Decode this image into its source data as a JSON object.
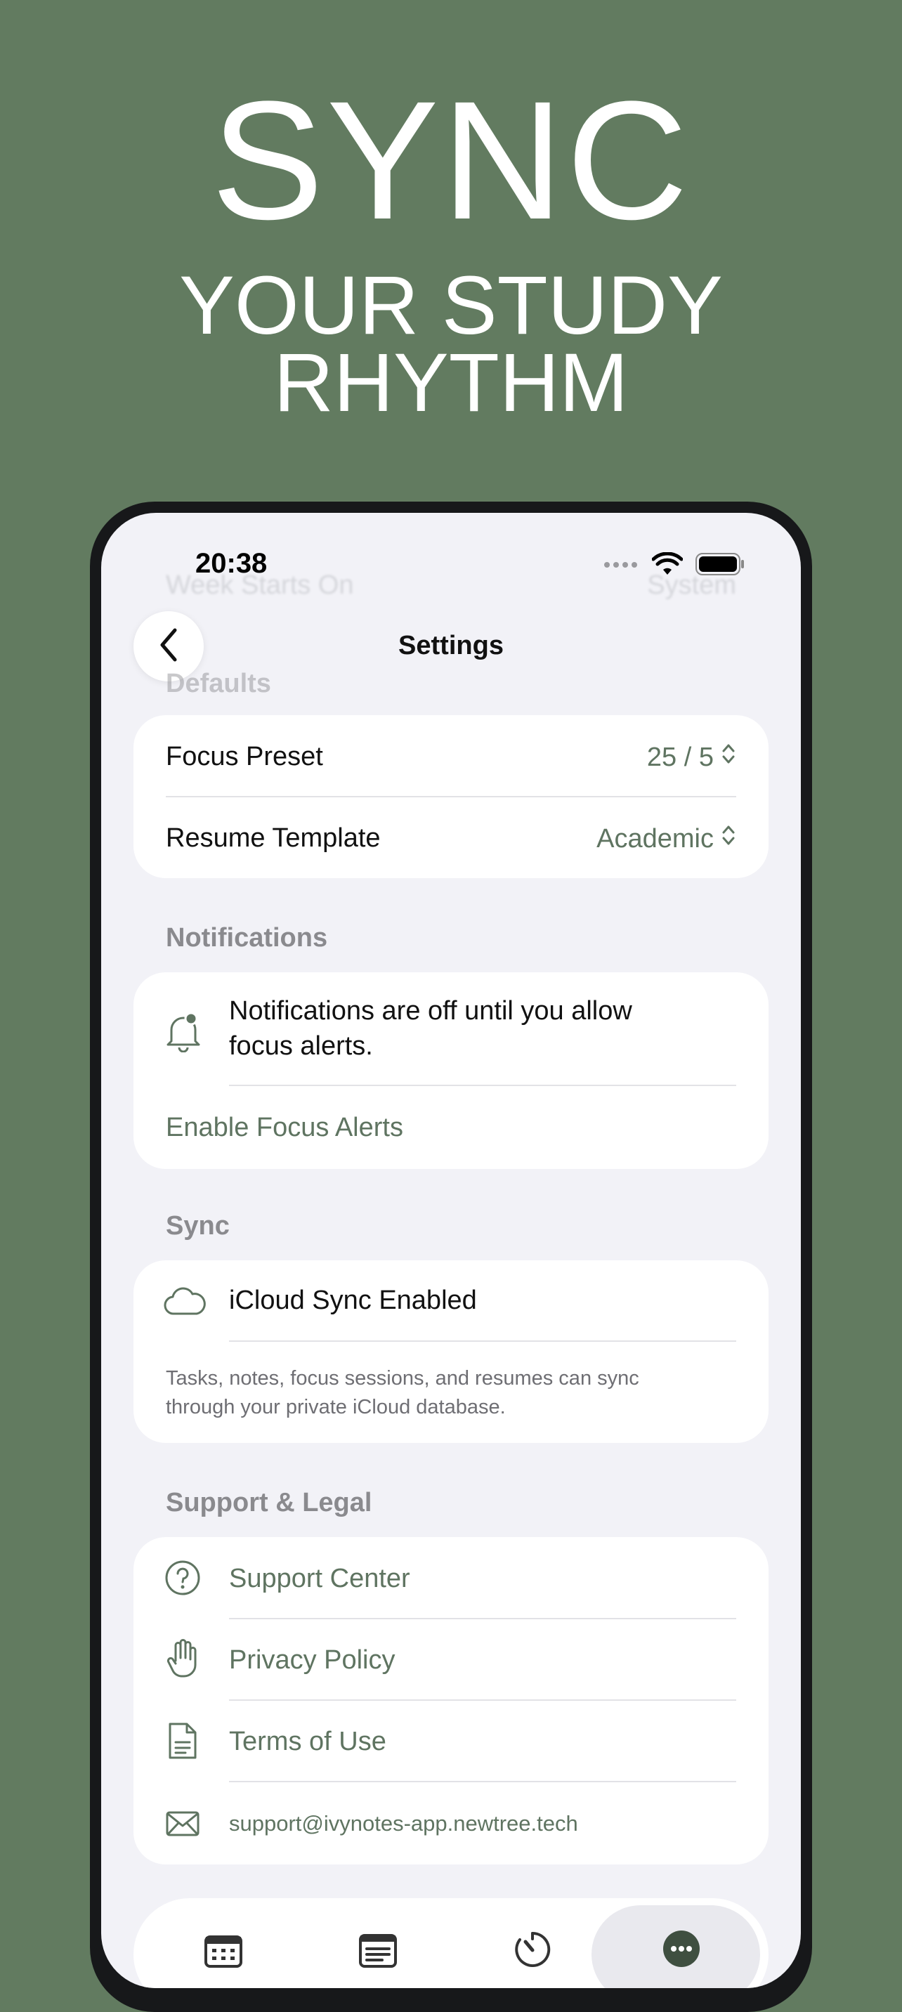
{
  "hero": {
    "title": "SYNC",
    "subtitle_line1": "YOUR STUDY",
    "subtitle_line2": "RHYTHM"
  },
  "status_bar": {
    "time": "20:38"
  },
  "nav": {
    "title": "Settings",
    "back_icon": "chevron-left-icon"
  },
  "ghost": {
    "week_starts_label": "Week Starts On",
    "week_starts_value": "System"
  },
  "sections": {
    "defaults": {
      "header": "Defaults",
      "rows": [
        {
          "label": "Focus Preset",
          "value": "25 / 5"
        },
        {
          "label": "Resume Template",
          "value": "Academic"
        }
      ]
    },
    "notifications": {
      "header": "Notifications",
      "message_line1": "Notifications are off until you allow",
      "message_line2": "focus alerts.",
      "action": "Enable Focus Alerts",
      "icon": "bell-badge-icon"
    },
    "sync": {
      "header": "Sync",
      "status": "iCloud Sync Enabled",
      "description_line1": "Tasks, notes, focus sessions, and resumes can sync",
      "description_line2": "through your private iCloud database.",
      "icon": "cloud-icon"
    },
    "support": {
      "header": "Support & Legal",
      "items": [
        {
          "label": "Support Center",
          "icon": "question-circle-icon"
        },
        {
          "label": "Privacy Policy",
          "icon": "hand-icon"
        },
        {
          "label": "Terms of Use",
          "icon": "document-icon"
        },
        {
          "label": "support@ivynotes-app.newtree.tech",
          "icon": "envelope-icon"
        }
      ]
    }
  },
  "tab_bar": {
    "tabs": [
      {
        "icon": "calendar-icon",
        "active": false
      },
      {
        "icon": "notes-icon",
        "active": false
      },
      {
        "icon": "timer-icon",
        "active": false
      },
      {
        "icon": "more-icon",
        "active": true
      }
    ]
  },
  "colors": {
    "background": "#627b60",
    "accent": "#5f7461",
    "card": "#ffffff",
    "screen": "#f2f2f7"
  }
}
